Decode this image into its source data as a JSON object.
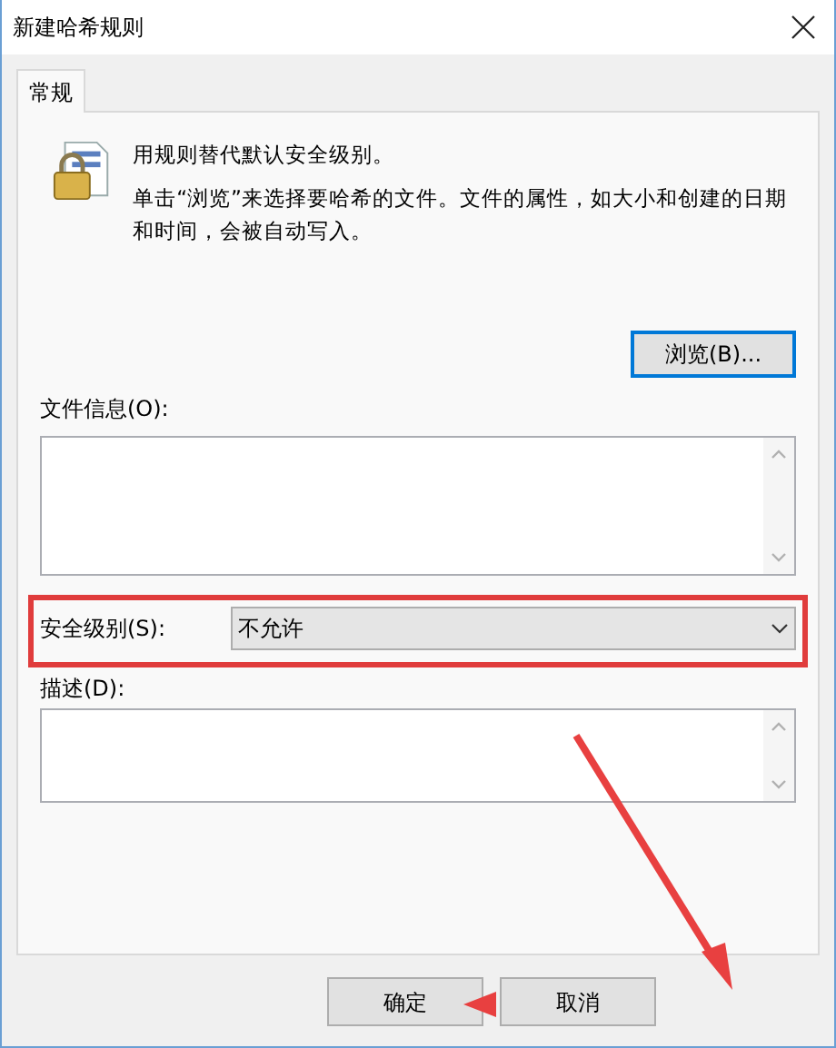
{
  "window": {
    "title": "新建哈希规则"
  },
  "tabs": [
    {
      "label": "常规",
      "selected": true
    }
  ],
  "intro": [
    "用规则替代默认安全级别。",
    "单击“浏览”来选择要哈希的文件。文件的属性，如大小和创建的日期和时间，会被自动写入。"
  ],
  "browse_button": "浏览(B)...",
  "file_info": {
    "label": "文件信息(O):"
  },
  "security_level": {
    "label": "安全级别(S):",
    "value": "不允许"
  },
  "description": {
    "label": "描述(D):"
  },
  "buttons": [
    {
      "label": "确定"
    },
    {
      "label": "取消"
    }
  ]
}
